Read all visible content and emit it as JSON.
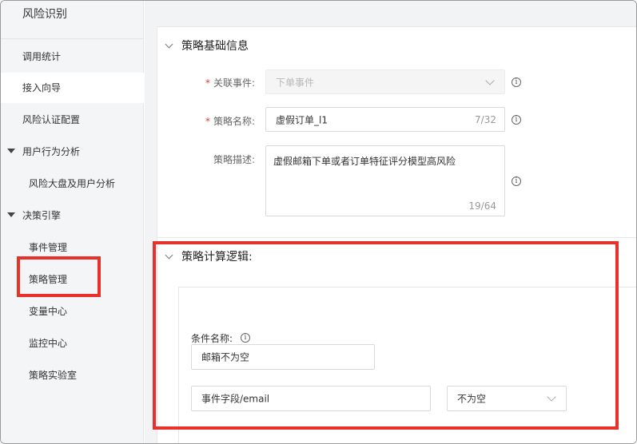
{
  "sidebar": {
    "title": "风险识别",
    "items": [
      {
        "label": "调用统计"
      },
      {
        "label": "接入向导"
      },
      {
        "label": "风险认证配置"
      },
      {
        "label": "用户行为分析"
      },
      {
        "label": "风险大盘及用户分析"
      },
      {
        "label": "决策引擎"
      },
      {
        "label": "事件管理"
      },
      {
        "label": "策略管理"
      },
      {
        "label": "变量中心"
      },
      {
        "label": "监控中心"
      },
      {
        "label": "策略实验室"
      }
    ]
  },
  "basic": {
    "title": "策略基础信息",
    "event_label": "关联事件:",
    "event_value": "下单事件",
    "name_label": "策略名称:",
    "name_value": "虚假订单_l1",
    "name_count": "7/32",
    "desc_label": "策略描述:",
    "desc_value": "虚假邮箱下单或者订单特征评分模型高风险",
    "desc_count": "19/64"
  },
  "logic": {
    "title": "策略计算逻辑:",
    "cond_label": "条件名称:",
    "cond_value": "邮箱不为空",
    "field_value": "事件字段/email",
    "operator_value": "不为空"
  },
  "colors": {
    "highlight": "#e8312b",
    "required": "#e23b3b"
  }
}
